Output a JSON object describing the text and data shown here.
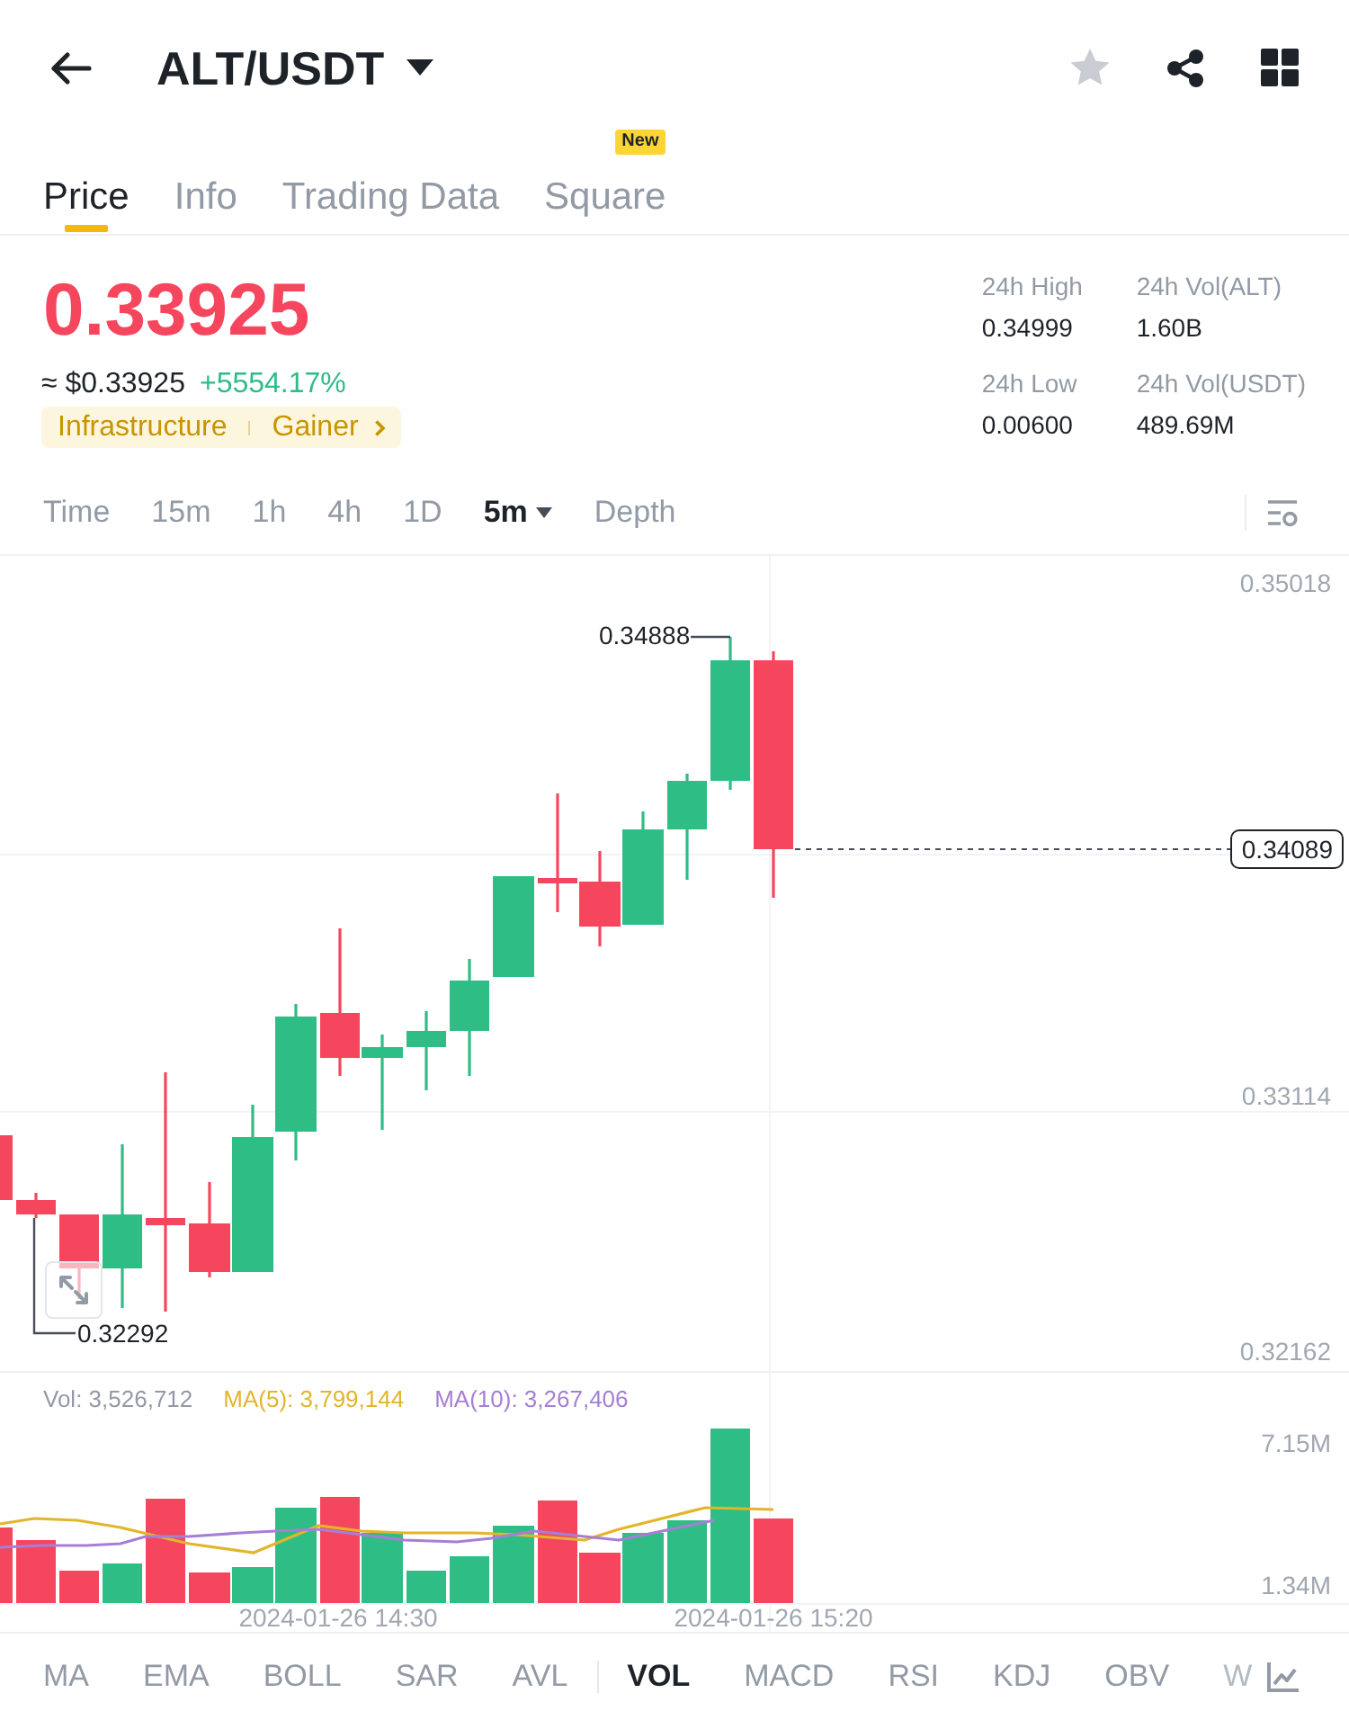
{
  "header": {
    "title": "ALT/USDT"
  },
  "tabs": [
    {
      "label": "Price",
      "selected": true
    },
    {
      "label": "Info",
      "selected": false
    },
    {
      "label": "Trading Data",
      "selected": false
    },
    {
      "label": "Square",
      "selected": false,
      "badge": "New"
    }
  ],
  "ticker": {
    "price": "0.33925",
    "fiat_price": "≈ $0.33925",
    "change": "+5554.17%",
    "tags": [
      "Infrastructure",
      "Gainer"
    ]
  },
  "stats": [
    {
      "label": "24h High",
      "value": "0.34999"
    },
    {
      "label": "24h Vol(ALT)",
      "value": "1.60B"
    },
    {
      "label": "24h Low",
      "value": "0.00600"
    },
    {
      "label": "24h Vol(USDT)",
      "value": "489.69M"
    }
  ],
  "intervals": [
    {
      "label": "Time",
      "selected": false,
      "dropdown": false
    },
    {
      "label": "15m",
      "selected": false,
      "dropdown": false
    },
    {
      "label": "1h",
      "selected": false,
      "dropdown": false
    },
    {
      "label": "4h",
      "selected": false,
      "dropdown": false
    },
    {
      "label": "1D",
      "selected": false,
      "dropdown": false
    },
    {
      "label": "5m",
      "selected": true,
      "dropdown": true
    },
    {
      "label": "Depth",
      "selected": false,
      "dropdown": false
    }
  ],
  "price_chart": {
    "axis_labels": [
      "0.35018",
      "0.33114",
      "0.32162"
    ],
    "current_price": "0.34089",
    "high_marker": "0.34888",
    "low_marker": "0.32292"
  },
  "volume_chart": {
    "legend": [
      {
        "text": "Vol: 3,526,712",
        "color": "#929aa5"
      },
      {
        "text": "MA(5): 3,799,144",
        "color": "#e2b52b"
      },
      {
        "text": "MA(10): 3,267,406",
        "color": "#a67fd4"
      }
    ],
    "axis_labels": [
      "7.15M",
      "1.34M"
    ],
    "time_labels": [
      "2024-01-26 14:30",
      "2024-01-26 15:20"
    ]
  },
  "indicators": {
    "main": [
      {
        "label": "MA",
        "selected": false
      },
      {
        "label": "EMA",
        "selected": false
      },
      {
        "label": "BOLL",
        "selected": false
      },
      {
        "label": "SAR",
        "selected": false
      },
      {
        "label": "AVL",
        "selected": false
      }
    ],
    "sub": [
      {
        "label": "VOL",
        "selected": true
      },
      {
        "label": "MACD",
        "selected": false
      },
      {
        "label": "RSI",
        "selected": false
      },
      {
        "label": "KDJ",
        "selected": false
      },
      {
        "label": "OBV",
        "selected": false
      },
      {
        "label": "W",
        "selected": false
      }
    ]
  }
}
